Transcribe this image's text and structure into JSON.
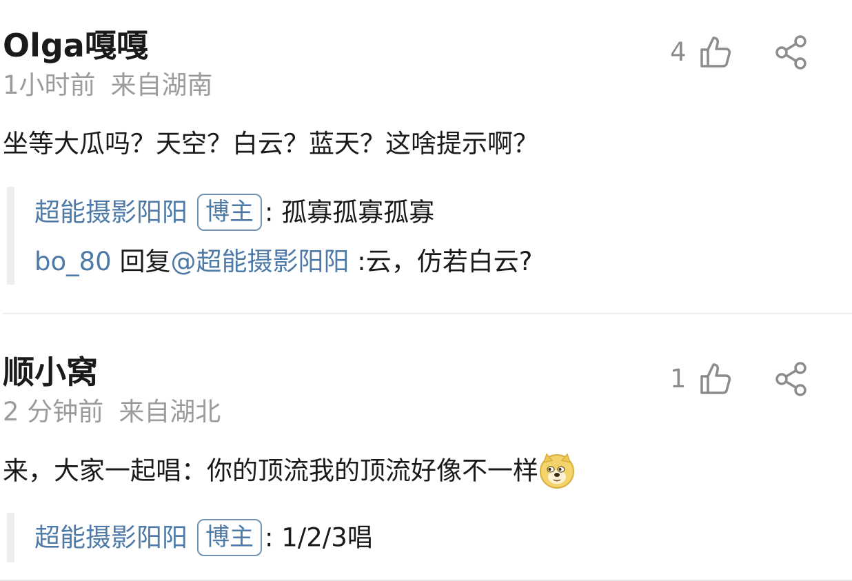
{
  "comments": [
    {
      "username": "Olga嘎嘎",
      "time": "1小时前",
      "location": "来自湖南",
      "like_count": "4",
      "body": "坐等大瓜吗？天空？白云？蓝天？这啥提示啊？",
      "replies": [
        {
          "author": "超能摄影阳阳",
          "badge": "博主",
          "text": ": 孤寡孤寡孤寡"
        },
        {
          "author": "bo_80",
          "action": " 回复",
          "mention": "@超能摄影阳阳",
          "text": " :云，仿若白云?"
        }
      ]
    },
    {
      "username": "顺小窝",
      "time": "2 分钟前",
      "location": "来自湖北",
      "like_count": "1",
      "body": "来，大家一起唱：你的顶流我的顶流好像不一样",
      "emoji": "doge-emoji",
      "replies": [
        {
          "author": "超能摄影阳阳",
          "badge": "博主",
          "text": ": 1/2/3唱"
        }
      ]
    }
  ],
  "icons": {
    "like": "thumbs-up-icon",
    "share": "share-icon"
  },
  "colors": {
    "link": "#4e7aa8",
    "meta": "#9b9b9b",
    "text": "#1a1a1a",
    "reply_bar": "#eeeeee"
  }
}
